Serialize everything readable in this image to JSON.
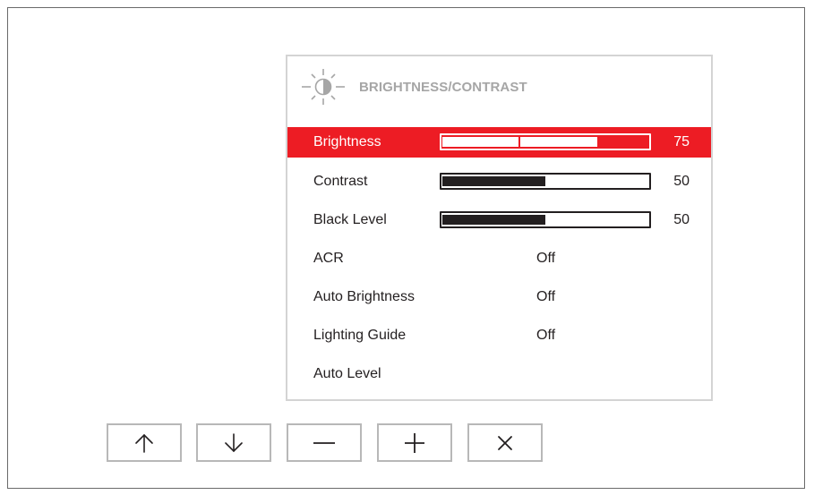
{
  "menu": {
    "icon": "brightness-contrast-icon",
    "title": "BRIGHTNESS/CONTRAST",
    "items": [
      {
        "label": "Brightness",
        "value": "75",
        "level": 75,
        "selected": true
      },
      {
        "label": "Contrast",
        "value": "50",
        "level": 50,
        "selected": false
      },
      {
        "label": "Black Level",
        "value": "50",
        "level": 50,
        "selected": false
      },
      {
        "label": "ACR",
        "setting": "Off"
      },
      {
        "label": "Auto Brightness",
        "setting": "Off"
      },
      {
        "label": "Lighting Guide",
        "setting": "Off"
      },
      {
        "label": "Auto Level"
      }
    ]
  },
  "buttons": [
    {
      "icon": "arrow-up-icon"
    },
    {
      "icon": "arrow-down-icon"
    },
    {
      "icon": "minus-icon"
    },
    {
      "icon": "plus-icon"
    },
    {
      "icon": "close-icon"
    }
  ],
  "colors": {
    "accent": "#ed1c24",
    "text": "#231f20",
    "header_text": "#a6a6a6",
    "panel_border": "#d4d4d4"
  }
}
